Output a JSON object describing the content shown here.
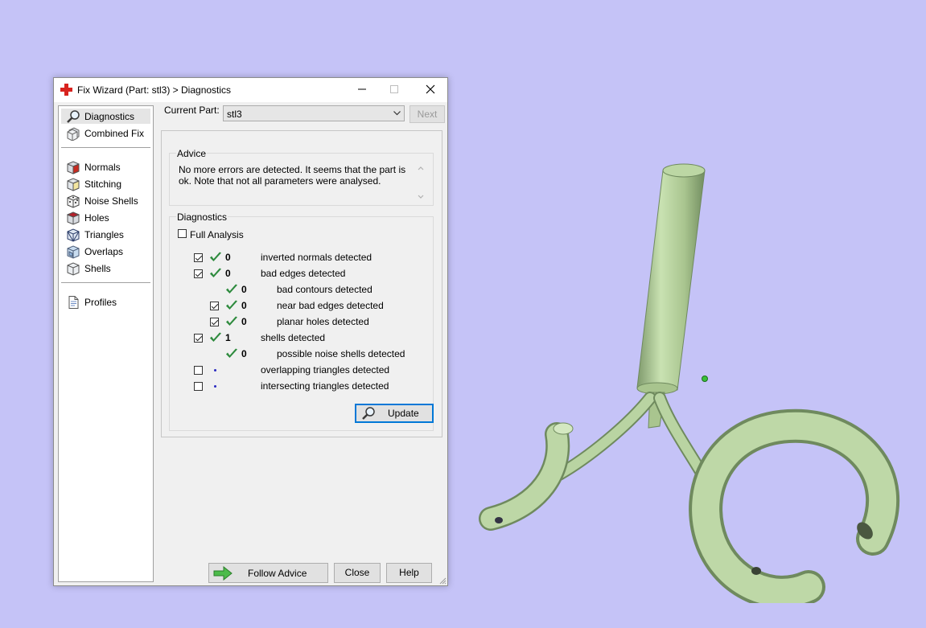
{
  "window": {
    "title": "Fix Wizard (Part: stl3) > Diagnostics"
  },
  "sidebar": {
    "items": [
      {
        "label": "Diagnostics",
        "icon": "magnifier-icon",
        "selected": true
      },
      {
        "label": "Combined Fix",
        "icon": "cube-combined-icon"
      },
      {
        "label": "Normals",
        "icon": "cube-normals-icon"
      },
      {
        "label": "Stitching",
        "icon": "cube-stitching-icon"
      },
      {
        "label": "Noise Shells",
        "icon": "dice-icon"
      },
      {
        "label": "Holes",
        "icon": "cube-holes-icon"
      },
      {
        "label": "Triangles",
        "icon": "cube-triangles-icon"
      },
      {
        "label": "Overlaps",
        "icon": "cube-overlaps-icon"
      },
      {
        "label": "Shells",
        "icon": "cube-shells-icon"
      },
      {
        "label": "Profiles",
        "icon": "document-icon"
      }
    ]
  },
  "current_part": {
    "label": "Current Part:",
    "value": "stl3",
    "next_label": "Next"
  },
  "advice": {
    "legend": "Advice",
    "text": "No more errors are detected. It seems that the part is ok. Note that not all parameters were analysed."
  },
  "diagnostics": {
    "legend": "Diagnostics",
    "full_analysis_label": "Full Analysis",
    "full_analysis_checked": false,
    "rows": [
      {
        "count": "0",
        "text": "inverted normals detected",
        "checked": true,
        "checkbox": true,
        "level": 0,
        "status": "ok"
      },
      {
        "count": "0",
        "text": "bad edges detected",
        "checked": true,
        "checkbox": true,
        "level": 0,
        "status": "ok"
      },
      {
        "count": "0",
        "text": "bad contours detected",
        "checked": false,
        "checkbox": false,
        "level": 1,
        "status": "ok"
      },
      {
        "count": "0",
        "text": "near bad edges detected",
        "checked": true,
        "checkbox": true,
        "level": 1,
        "status": "ok"
      },
      {
        "count": "0",
        "text": "planar holes detected",
        "checked": true,
        "checkbox": true,
        "level": 1,
        "status": "ok"
      },
      {
        "count": "1",
        "text": "shells detected",
        "checked": true,
        "checkbox": true,
        "level": 0,
        "status": "ok"
      },
      {
        "count": "0",
        "text": "possible noise shells detected",
        "checked": false,
        "checkbox": false,
        "level": 1,
        "status": "ok"
      },
      {
        "count": "",
        "text": "overlapping triangles detected",
        "checked": false,
        "checkbox": true,
        "level": 0,
        "status": "pending"
      },
      {
        "count": "",
        "text": "intersecting triangles detected",
        "checked": false,
        "checkbox": true,
        "level": 0,
        "status": "pending"
      }
    ],
    "update_label": "Update"
  },
  "footer": {
    "follow_advice_label": "Follow Advice",
    "close_label": "Close",
    "help_label": "Help"
  },
  "colors": {
    "viewport_bg": "#c5c3f7",
    "model": "#b8d4a0",
    "tick": "#2e8b3e"
  }
}
